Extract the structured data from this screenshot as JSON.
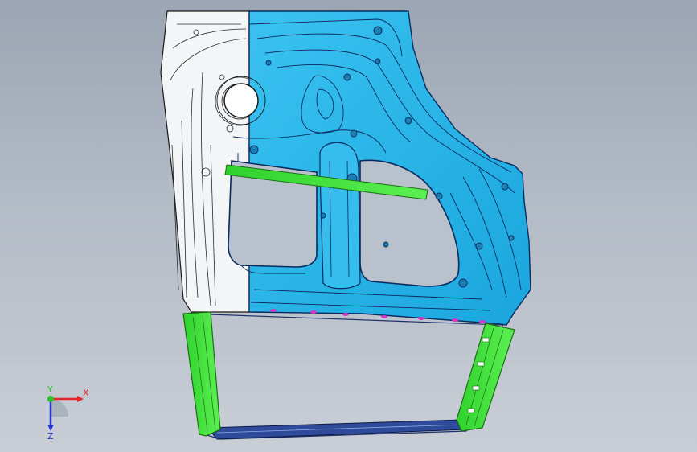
{
  "viewport": {
    "background_top": "#9ba5b3",
    "background_bottom": "#c9ced6"
  },
  "model": {
    "colors": {
      "blue_panel": "#26b3e8",
      "blue_edge": "#0a2a5e",
      "white_panel": "#f4f5f7",
      "green_part": "#3ee43a",
      "green_edge": "#1c6b17",
      "magenta_clip": "#d437c4",
      "frame_dark": "#1d2f6a"
    }
  },
  "triad": {
    "x_label": "X",
    "y_label": "Y",
    "z_label": "Z",
    "x_color": "#e0282a",
    "y_color": "#2bc22b",
    "z_color": "#2433d6"
  }
}
